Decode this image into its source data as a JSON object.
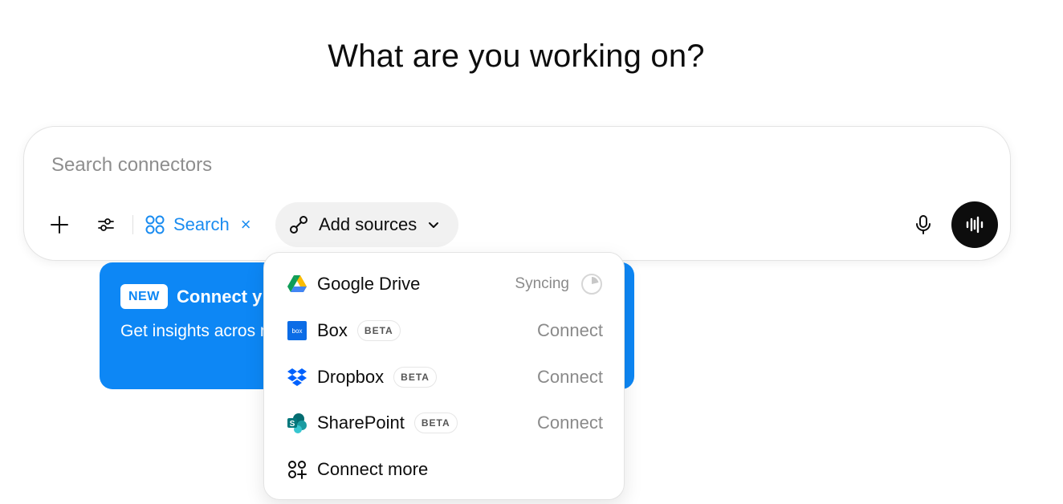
{
  "headline": "What are you working on?",
  "composer": {
    "placeholder": "Search connectors",
    "search_chip": {
      "label": "Search",
      "close": "×"
    },
    "add_sources": {
      "label": "Add sources"
    }
  },
  "promo": {
    "badge": "NEW",
    "title": "Connect y",
    "body": "Get insights acros more."
  },
  "dropdown": {
    "items": [
      {
        "label": "Google Drive",
        "status": "Syncing",
        "icon": "google-drive-icon"
      },
      {
        "label": "Box",
        "beta": "BETA",
        "action": "Connect",
        "icon": "box-icon"
      },
      {
        "label": "Dropbox",
        "beta": "BETA",
        "action": "Connect",
        "icon": "dropbox-icon"
      },
      {
        "label": "SharePoint",
        "beta": "BETA",
        "action": "Connect",
        "icon": "sharepoint-icon"
      },
      {
        "label": "Connect more",
        "icon": "connect-more-icon"
      }
    ]
  },
  "colors": {
    "accent": "#1a8cf0",
    "promo_bg": "#0d87f5",
    "voice_bg": "#0d0d0d"
  }
}
